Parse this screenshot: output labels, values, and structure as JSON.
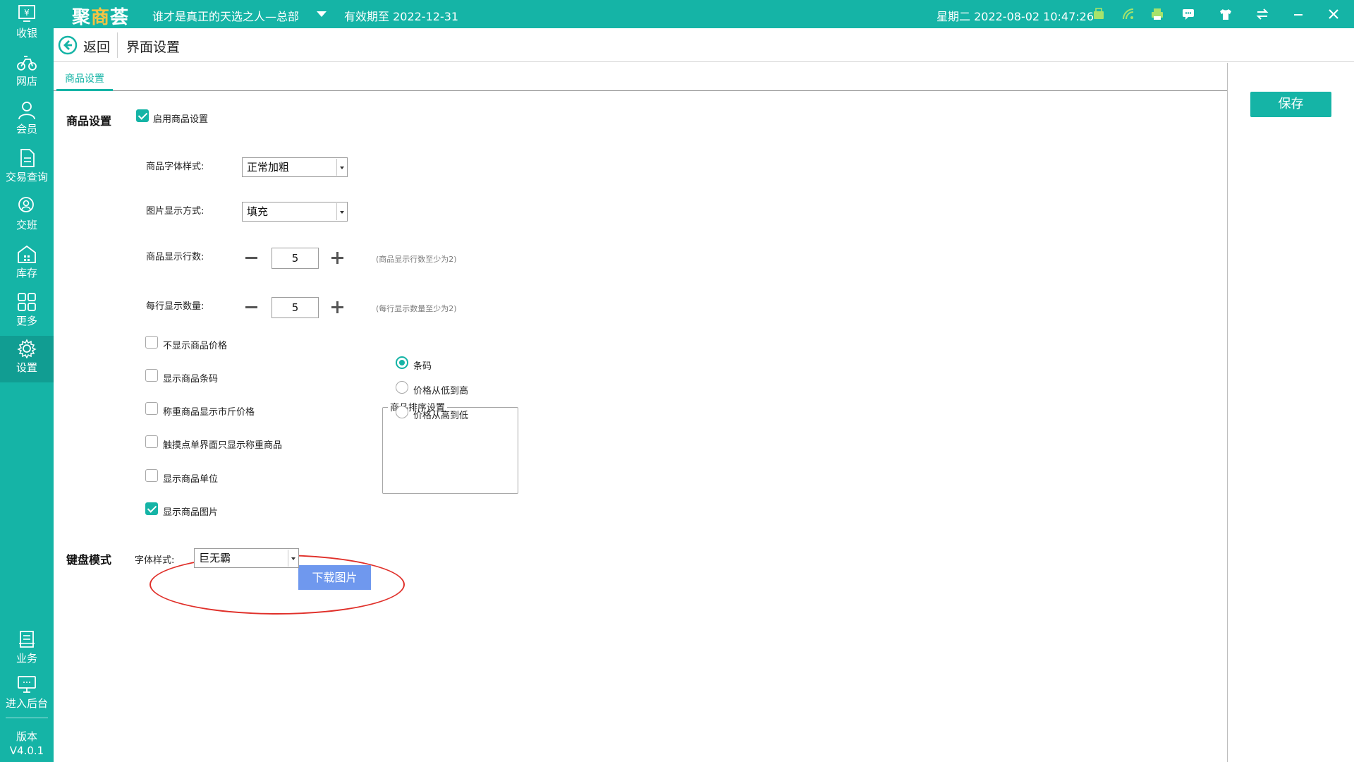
{
  "topbar": {
    "brand_main": "聚",
    "brand_hl": "商",
    "brand_tail": "荟",
    "store_name": "谁才是真正的天选之人—总部",
    "expiry": "有效期至 2022-12-31",
    "datetime": "星期二 2022-08-02 10:47:26",
    "tray_icons": [
      "cashbox-icon",
      "wifi-icon",
      "printer-icon",
      "message-icon",
      "tshirt-icon",
      "switch-icon",
      "minimize-icon",
      "close-icon"
    ]
  },
  "sidebar": {
    "items": [
      {
        "label": "收银",
        "icon": "cashier-icon"
      },
      {
        "label": "网店",
        "icon": "bike-icon"
      },
      {
        "label": "会员",
        "icon": "member-icon"
      },
      {
        "label": "交易查询",
        "icon": "document-icon"
      },
      {
        "label": "交班",
        "icon": "shift-icon"
      },
      {
        "label": "库存",
        "icon": "warehouse-icon"
      },
      {
        "label": "更多",
        "icon": "grid-icon"
      },
      {
        "label": "设置",
        "icon": "gear-icon"
      }
    ],
    "bottom_items": [
      {
        "label": "业务",
        "icon": "business-icon"
      },
      {
        "label": "进入后台",
        "icon": "monitor-icon"
      }
    ],
    "version_label": "版本",
    "version": "V4.0.1",
    "active": "设置"
  },
  "header": {
    "back_label": "返回",
    "page_title": "界面设置"
  },
  "tabs": [
    {
      "label": "商品设置",
      "active": true
    }
  ],
  "save_label": "保存",
  "product_settings": {
    "section_title": "商品设置",
    "enable_label": "启用商品设置",
    "enable_checked": true,
    "font_style_label": "商品字体样式:",
    "font_style_value": "正常加粗",
    "image_mode_label": "图片显示方式:",
    "image_mode_value": "填充",
    "rows_label": "商品显示行数:",
    "rows_value": "5",
    "rows_hint": "(商品显示行数至少为2)",
    "per_row_label": "每行显示数量:",
    "per_row_value": "5",
    "per_row_hint": "(每行显示数量至少为2)",
    "options": [
      {
        "label": "不显示商品价格",
        "checked": false
      },
      {
        "label": "显示商品条码",
        "checked": false
      },
      {
        "label": "称重商品显示市斤价格",
        "checked": false
      },
      {
        "label": "触摸点单界面只显示称重商品",
        "checked": false
      },
      {
        "label": "显示商品单位",
        "checked": false
      },
      {
        "label": "显示商品图片",
        "checked": true
      }
    ],
    "download_label": "下载图片",
    "sort_group": {
      "title": "商品排序设置",
      "options": [
        {
          "label": "条码",
          "checked": true
        },
        {
          "label": "价格从低到高",
          "checked": false
        },
        {
          "label": "价格从高到低",
          "checked": false
        }
      ]
    }
  },
  "keyboard_mode": {
    "section_title": "键盘模式",
    "font_label": "字体样式:",
    "font_value": "巨无霸"
  },
  "colors": {
    "accent": "#15b4a6",
    "download_button": "#6f98ee",
    "highlight": "#e0302a"
  }
}
